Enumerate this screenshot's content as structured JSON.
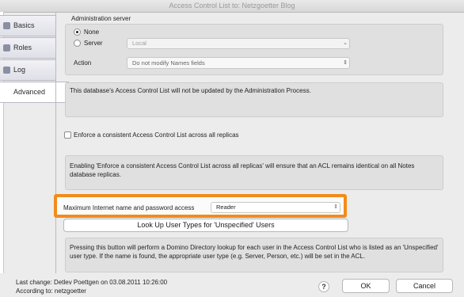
{
  "window": {
    "title": "Access Control List to: Netzgoetter Blog"
  },
  "tabs": [
    {
      "label": "Basics"
    },
    {
      "label": "Roles"
    },
    {
      "label": "Log"
    },
    {
      "label": "Advanced"
    }
  ],
  "admin": {
    "heading": "Administration server",
    "none_label": "None",
    "server_label": "Server",
    "server_value": "Local",
    "action_label": "Action",
    "action_value": "Do not modify Names fields",
    "note": "This database's Access Control List will not be updated by the Administration Process."
  },
  "enforce": {
    "checkbox_label": "Enforce a consistent Access Control List across all replicas",
    "note": "Enabling 'Enforce a consistent Access Control List across all replicas' will ensure that an ACL remains identical on all Notes database replicas."
  },
  "internet": {
    "label": "Maximum Internet name and password access",
    "value": "Reader"
  },
  "lookup": {
    "button_label": "Look Up User Types for 'Unspecified' Users",
    "note": "Pressing this button will perform a Domino Directory lookup for each user in the Access Control List who is listed as an 'Unspecified' user type.  If the name is found, the appropriate user type (e.g. Server, Person, etc.) will be set in the ACL."
  },
  "footer": {
    "last_change": "Last change: Detlev Poettgen on 03.08.2011 10:26:00",
    "according": "According to: netzgoetter",
    "help_glyph": "?",
    "ok_label": "OK",
    "cancel_label": "Cancel"
  },
  "colors": {
    "highlight": "#f28c1c"
  }
}
